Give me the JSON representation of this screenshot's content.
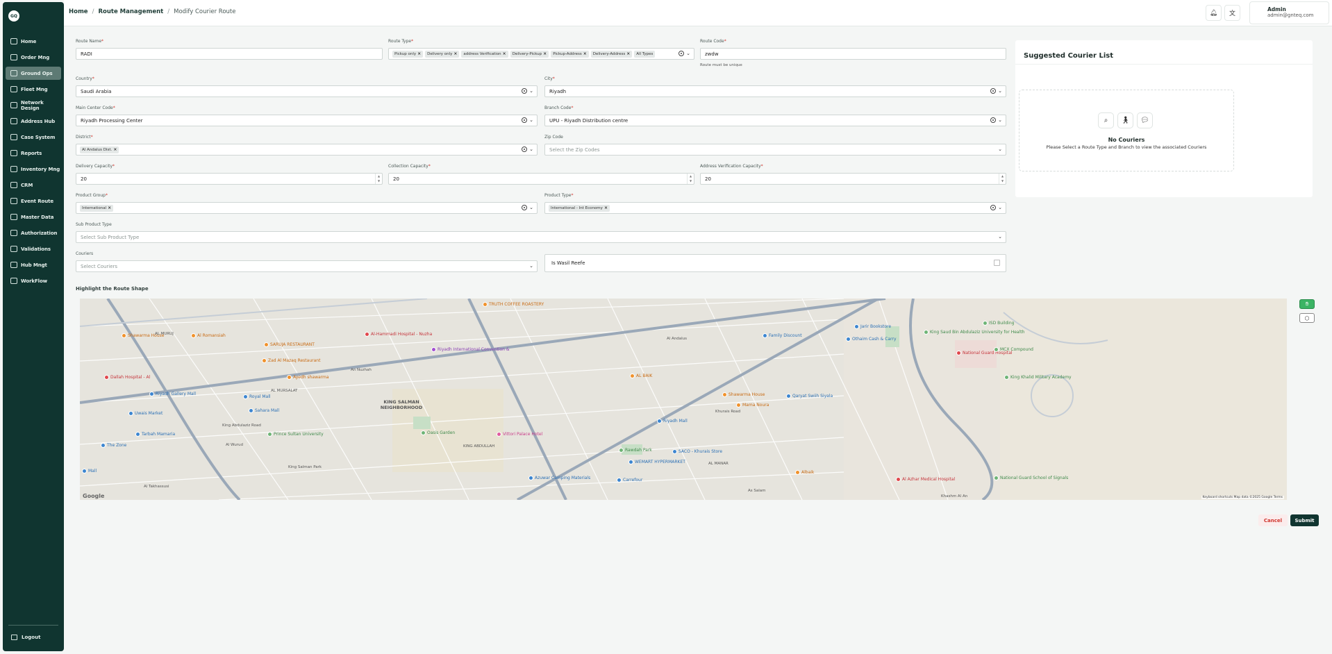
{
  "sidebar": {
    "logo": "GQ",
    "items": [
      {
        "label": "Home",
        "icon": "home-icon"
      },
      {
        "label": "Order Mng",
        "icon": "order-icon"
      },
      {
        "label": "Ground Ops",
        "icon": "ground-icon",
        "active": true
      },
      {
        "label": "Fleet Mng",
        "icon": "truck-icon"
      },
      {
        "label": "Network Design",
        "icon": "network-icon"
      },
      {
        "label": "Address Hub",
        "icon": "address-icon"
      },
      {
        "label": "Case System",
        "icon": "case-icon"
      },
      {
        "label": "Reports",
        "icon": "report-icon"
      },
      {
        "label": "Inventory Mng",
        "icon": "inventory-icon"
      },
      {
        "label": "CRM",
        "icon": "crm-icon"
      },
      {
        "label": "Event Route",
        "icon": "event-icon"
      },
      {
        "label": "Master Data",
        "icon": "data-icon"
      },
      {
        "label": "Authorization",
        "icon": "auth-icon"
      },
      {
        "label": "Validations",
        "icon": "validation-icon"
      },
      {
        "label": "Hub Mngt",
        "icon": "hub-icon"
      },
      {
        "label": "WorkFlow",
        "icon": "workflow-icon"
      }
    ],
    "logout": "Logout"
  },
  "header": {
    "breadcrumb": [
      "Home",
      "Route Management",
      "Modify Courier Route"
    ],
    "user_name": "Admin",
    "user_email": "admin@gnteq.com"
  },
  "form": {
    "route_name": {
      "label": "Route Name",
      "value": "RADI"
    },
    "route_type": {
      "label": "Route Type",
      "chips": [
        "Pickup only",
        "Delivery only",
        "address Verification",
        "Delivery-Pickup",
        "Pickup-Address",
        "Delivery-Address",
        "All Types"
      ]
    },
    "route_code": {
      "label": "Route Code",
      "value": "zwdw",
      "hint": "Route must be unique"
    },
    "country": {
      "label": "Country",
      "value": "Saudi Arabia"
    },
    "city": {
      "label": "City",
      "value": "Riyadh"
    },
    "main_center": {
      "label": "Main Center Code",
      "value": "Riyadh Processing Center"
    },
    "branch": {
      "label": "Branch Code",
      "value": "UPU - Riyadh Distribution centre"
    },
    "district": {
      "label": "District",
      "chips": [
        "Al Andalus Dist."
      ]
    },
    "zip": {
      "label": "Zip Code",
      "placeholder": "Select the Zip Codes"
    },
    "delivery_capacity": {
      "label": "Delivery Capacity",
      "value": "20"
    },
    "collection_capacity": {
      "label": "Collection Capacity",
      "value": "20"
    },
    "address_capacity": {
      "label": "Address Verification Capacity",
      "value": "20"
    },
    "product_group": {
      "label": "Product Group",
      "chips": [
        "International"
      ]
    },
    "product_type": {
      "label": "Product Type",
      "chips": [
        "International - Int Economy"
      ]
    },
    "sub_product": {
      "label": "Sub Product Type",
      "placeholder": "Select Sub Product Type"
    },
    "couriers": {
      "label": "Couriers",
      "placeholder": "Select Couriers"
    },
    "wasil": {
      "label": "Is Wasil Reefe"
    }
  },
  "panel": {
    "title": "Suggested Courier List",
    "empty_title": "No Couriers",
    "empty_text": "Please Select a Route Type and Branch to view the associated Couriers"
  },
  "map": {
    "title": "Highlight the Route Shape",
    "footer": "Keyboard shortcuts   Map data ©2025 Google   Terms",
    "google": "Google",
    "areas": [
      "KING SALMAN NEIGHBORHOOD"
    ],
    "roads": [
      "King Abdulaziz Road",
      "Khurais Road",
      "King Salman Park",
      "An Nuzhah",
      "Al Andalus",
      "As Salam",
      "Khashm Al An",
      "Al Wurud",
      "Al Takhassusi",
      "AL MURUJ",
      "AL MURSALAT",
      "AL MANAR",
      "KING ABDULLAH"
    ],
    "pois": [
      {
        "label": "Shawarma House",
        "color": "orange"
      },
      {
        "label": "Al Romansiah",
        "color": "orange"
      },
      {
        "label": "SARUJA RESTAURANT",
        "color": "orange"
      },
      {
        "label": "Zad Al Mazaq Restaurant",
        "color": "orange"
      },
      {
        "label": "Ayedh shawarma",
        "color": "orange"
      },
      {
        "label": "TRUTH COFFEE ROASTERY",
        "color": "orange"
      },
      {
        "label": "AL BAIK",
        "color": "orange"
      },
      {
        "label": "Shawarma House",
        "color": "orange"
      },
      {
        "label": "Mama Noura",
        "color": "orange"
      },
      {
        "label": "Albaik",
        "color": "orange"
      },
      {
        "label": "Al-Hammadi Hospital - Nuzha",
        "color": "red"
      },
      {
        "label": "Dallah Hospital - Al",
        "color": "red"
      },
      {
        "label": "National Guard Hospital",
        "color": "red"
      },
      {
        "label": "Al Azhar Medical Hospital",
        "color": "red"
      },
      {
        "label": "Riyadh International Convention &",
        "color": "purple"
      },
      {
        "label": "Vittori Palace Hotel",
        "color": "pink"
      },
      {
        "label": "Riyadh Gallery Mall",
        "color": "blue"
      },
      {
        "label": "Royal Mall",
        "color": "blue"
      },
      {
        "label": "Sahara Mall",
        "color": "blue"
      },
      {
        "label": "Uwais Market",
        "color": "blue"
      },
      {
        "label": "Tarbah Mamaria",
        "color": "blue"
      },
      {
        "label": "The Zone",
        "color": "blue"
      },
      {
        "label": "Mall",
        "color": "blue"
      },
      {
        "label": "Riyadh Mall",
        "color": "blue"
      },
      {
        "label": "SACO - Khurais Store",
        "color": "blue"
      },
      {
        "label": "WEMART HYPERMARKET",
        "color": "blue"
      },
      {
        "label": "Carrefour",
        "color": "blue"
      },
      {
        "label": "Azuwar Camping Materials",
        "color": "blue"
      },
      {
        "label": "Family Discount",
        "color": "blue"
      },
      {
        "label": "Qaryat Swiih Siyala",
        "color": "blue"
      },
      {
        "label": "Jarir Bookstore",
        "color": "blue"
      },
      {
        "label": "Othaim Cash & Carry",
        "color": "blue"
      },
      {
        "label": "Prince Sultan University",
        "color": "green"
      },
      {
        "label": "Oasis Garden",
        "color": "green"
      },
      {
        "label": "Rawdah Park",
        "color": "green"
      },
      {
        "label": "King Saud Bin Abdulaziz University for Health",
        "color": "green"
      },
      {
        "label": "ISD Building",
        "color": "green"
      },
      {
        "label": "MCX Compound",
        "color": "green"
      },
      {
        "label": "King Khalid Military Academy",
        "color": "green"
      },
      {
        "label": "National Guard School of Signals",
        "color": "green"
      }
    ]
  },
  "actions": {
    "cancel": "Cancel",
    "submit": "Submit"
  },
  "colors": {
    "sidebar": "#103530",
    "accent": "#103530",
    "danger": "#d0342c",
    "draw_active": "#3cb464"
  }
}
